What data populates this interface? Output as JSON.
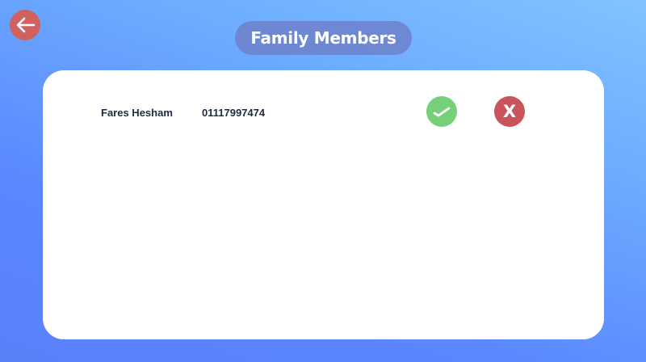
{
  "header": {
    "title": "Family Members",
    "back_icon": "arrow-left-icon"
  },
  "members": [
    {
      "name": "Fares Hesham",
      "phone": "01117997474",
      "accept_icon": "check-icon",
      "reject_label": "X"
    }
  ],
  "colors": {
    "back_button": "#d0615f",
    "accept_button": "#76d07a",
    "reject_button": "#c9545c",
    "text": "#1d2b40"
  }
}
